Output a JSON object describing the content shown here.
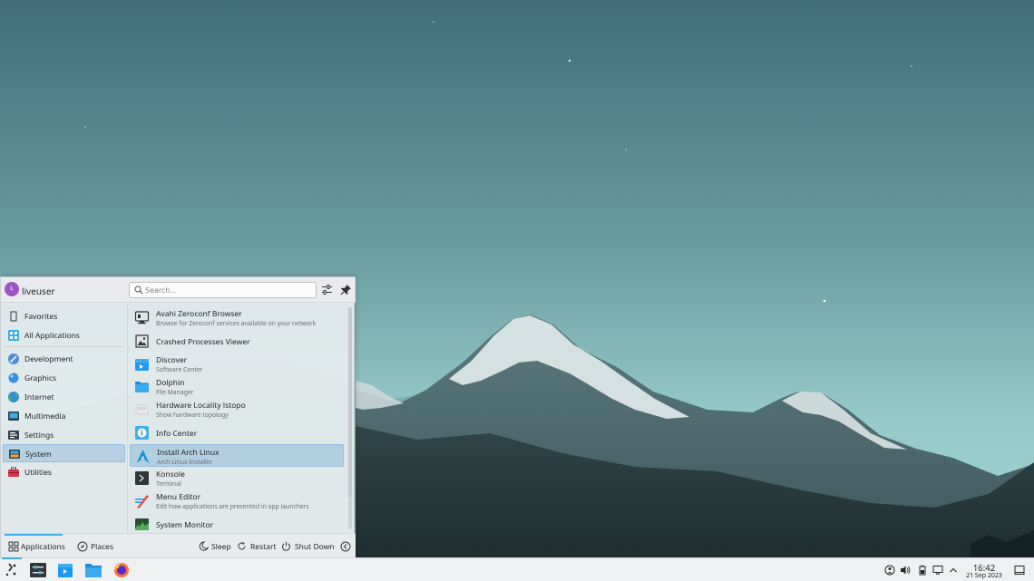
{
  "launcher": {
    "user": {
      "avatar_letter": "L",
      "name": "liveuser"
    },
    "search": {
      "placeholder": "Search..."
    },
    "header_icons": [
      "configure-icon",
      "pin-icon"
    ],
    "categories": [
      {
        "label": "Favorites",
        "icon": "bookmark-icon"
      },
      {
        "label": "All Applications",
        "icon": "grid-icon"
      },
      {
        "label": "Development",
        "icon": "development-icon"
      },
      {
        "label": "Graphics",
        "icon": "graphics-icon"
      },
      {
        "label": "Internet",
        "icon": "globe-icon"
      },
      {
        "label": "Multimedia",
        "icon": "multimedia-icon"
      },
      {
        "label": "Settings",
        "icon": "settings-icon"
      },
      {
        "label": "System",
        "icon": "system-icon",
        "selected": true
      },
      {
        "label": "Utilities",
        "icon": "toolbox-icon"
      }
    ],
    "apps": [
      {
        "name": "Avahi Zeroconf Browser",
        "desc": "Browse for Zeroconf services available on your network",
        "icon": "network-monitor-icon"
      },
      {
        "name": "Crashed Processes Viewer",
        "desc": "",
        "icon": "image-viewer-icon"
      },
      {
        "name": "Discover",
        "desc": "Software Center",
        "icon": "discover-icon"
      },
      {
        "name": "Dolphin",
        "desc": "File Manager",
        "icon": "folder-icon"
      },
      {
        "name": "Hardware Locality lstopo",
        "desc": "Show hardware topology",
        "icon": "hardware-icon"
      },
      {
        "name": "Info Center",
        "desc": "",
        "icon": "info-icon"
      },
      {
        "name": "Install Arch Linux",
        "desc": "Arch Linux Installer",
        "icon": "arch-linux-icon",
        "selected": true
      },
      {
        "name": "Konsole",
        "desc": "Terminal",
        "icon": "terminal-icon"
      },
      {
        "name": "Menu Editor",
        "desc": "Edit how applications are presented in app launchers",
        "icon": "menu-editor-icon"
      },
      {
        "name": "System Monitor",
        "desc": "",
        "icon": "system-monitor-icon"
      }
    ],
    "footer": {
      "tabs": [
        {
          "label": "Applications",
          "icon": "applications-grid-icon",
          "active": true
        },
        {
          "label": "Places",
          "icon": "compass-icon"
        }
      ],
      "power": [
        {
          "label": "Sleep",
          "icon": "sleep-icon"
        },
        {
          "label": "Restart",
          "icon": "restart-icon"
        },
        {
          "label": "Shut Down",
          "icon": "power-icon"
        }
      ],
      "collapse_icon": "chevron-left-icon"
    }
  },
  "taskbar": {
    "pinned": [
      "launcher-icon",
      "system-settings-icon",
      "discover-icon",
      "folder-icon",
      "firefox-icon"
    ],
    "tray": [
      "network-icon",
      "volume-icon",
      "battery-icon",
      "display-icon",
      "chevron-up-icon"
    ],
    "clock": {
      "time": "16:42",
      "date": "21 Sep 2023"
    },
    "show_desktop_icon": "show-desktop-icon"
  },
  "colors": {
    "accent": "#3daee9",
    "selection": "#93bde0",
    "avatar": "#9a56c7",
    "text": "#232629",
    "secondary_text": "#6d7073"
  }
}
